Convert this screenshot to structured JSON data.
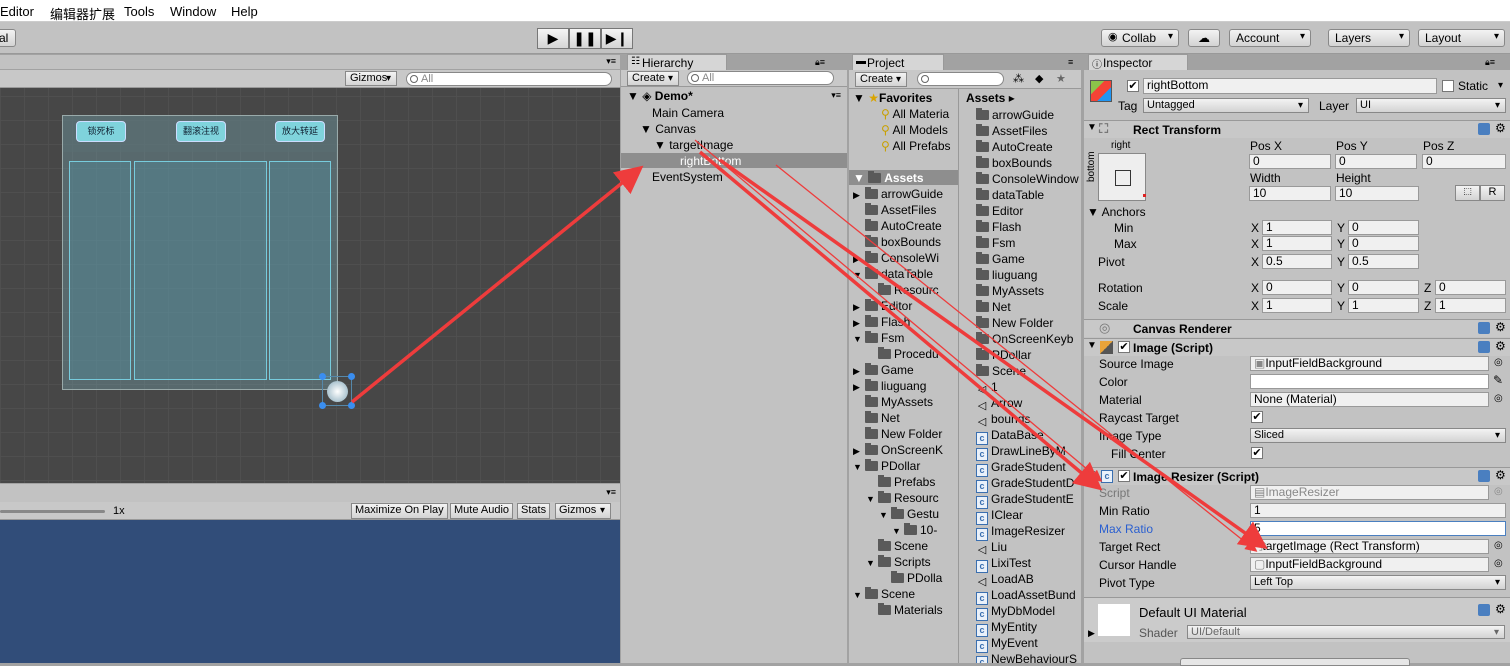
{
  "menu": {
    "items": [
      "Editor",
      "编辑器扩展",
      "Tools",
      "Window",
      "Help"
    ]
  },
  "toolbar": {
    "left_partial": "al",
    "collab": "Collab",
    "account": "Account",
    "layers": "Layers",
    "layout": "Layout"
  },
  "scene": {
    "gizmos": "Gizmos",
    "search_placeholder": "All",
    "ui_buttons": [
      "锁死标",
      "翻滚注视",
      "放大转延"
    ]
  },
  "game": {
    "scale_label": "1x",
    "buttons": [
      "Maximize On Play",
      "Mute Audio",
      "Stats",
      "Gizmos"
    ]
  },
  "hierarchy": {
    "tab": "Hierarchy",
    "create": "Create",
    "search_placeholder": "All",
    "items": [
      "Demo*",
      "Main Camera",
      "Canvas",
      "targetImage",
      "rightBottom",
      "EventSystem"
    ]
  },
  "project": {
    "tab": "Project",
    "create": "Create",
    "favorites": "Favorites",
    "fav_items": [
      "All Materia",
      "All Models",
      "All Prefabs"
    ],
    "assets_root": "Assets",
    "tree": [
      "arrowGuide",
      "AssetFiles",
      "AutoCreate",
      "boxBounds",
      "ConsoleWi",
      "dataTable",
      "Resourc",
      "Editor",
      "Flash",
      "Fsm",
      "Procedu",
      "Game",
      "liuguang",
      "MyAssets",
      "Net",
      "New Folder",
      "OnScreenK",
      "PDollar",
      "Prefabs",
      "Resourc",
      "Gestu",
      "10-",
      "Scene",
      "Scripts",
      "PDolla",
      "Scene",
      "Materials"
    ],
    "assets_header": "Assets",
    "assets": [
      "arrowGuide",
      "AssetFiles",
      "AutoCreate",
      "boxBounds",
      "ConsoleWindow",
      "dataTable",
      "Editor",
      "Flash",
      "Fsm",
      "Game",
      "liuguang",
      "MyAssets",
      "Net",
      "New Folder",
      "OnScreenKeyb",
      "PDollar",
      "Scene",
      "1",
      "Arrow",
      "bounds",
      "DataBase",
      "DrawLineByM",
      "GradeStudent",
      "GradeStudentD",
      "GradeStudentE",
      "IClear",
      "ImageResizer",
      "Liu",
      "LixiTest",
      "LoadAB",
      "LoadAssetBund",
      "MyDbModel",
      "MyEntity",
      "MyEvent",
      "NewBehaviourS"
    ],
    "asset_types": [
      "folder",
      "folder",
      "folder",
      "folder",
      "folder",
      "folder",
      "folder",
      "folder",
      "folder",
      "folder",
      "folder",
      "folder",
      "folder",
      "folder",
      "folder",
      "folder",
      "folder",
      "unity",
      "unity",
      "unity",
      "cs",
      "cs",
      "cs",
      "cs",
      "cs",
      "cs",
      "cs",
      "unity",
      "cs",
      "unity",
      "cs",
      "cs",
      "cs",
      "cs",
      "cs"
    ]
  },
  "inspector": {
    "tab": "Inspector",
    "object_name": "rightBottom",
    "static": "Static",
    "tag_label": "Tag",
    "tag_value": "Untagged",
    "layer_label": "Layer",
    "layer_value": "UI",
    "rect": {
      "title": "Rect Transform",
      "anchor_h": "right",
      "anchor_v": "bottom",
      "posx_label": "Pos X",
      "posy_label": "Pos Y",
      "posz_label": "Pos Z",
      "posx": "0",
      "posy": "0",
      "posz": "0",
      "width_label": "Width",
      "height_label": "Height",
      "width": "10",
      "height": "10",
      "r_button": "R",
      "anchors": "Anchors",
      "min": "Min",
      "max": "Max",
      "min_x": "1",
      "min_y": "0",
      "max_x": "1",
      "max_y": "0",
      "pivot": "Pivot",
      "pivot_x": "0.5",
      "pivot_y": "0.5",
      "rotation": "Rotation",
      "rot_x": "0",
      "rot_y": "0",
      "rot_z": "0",
      "scale": "Scale",
      "scale_x": "1",
      "scale_y": "1",
      "scale_z": "1",
      "x": "X",
      "y": "Y",
      "z": "Z"
    },
    "canvas_renderer": "Canvas Renderer",
    "image": {
      "title": "Image (Script)",
      "source_label": "Source Image",
      "source": "InputFieldBackground",
      "color_label": "Color",
      "material_label": "Material",
      "material": "None (Material)",
      "raycast_label": "Raycast Target",
      "type_label": "Image Type",
      "type": "Sliced",
      "fill_label": "Fill Center"
    },
    "resizer": {
      "title": "Image Resizer (Script)",
      "script_label": "Script",
      "script": "ImageResizer",
      "min_label": "Min Ratio",
      "min": "1",
      "max_label": "Max Ratio",
      "max": "5",
      "target_label": "Target Rect",
      "target": "targetImage (Rect Transform)",
      "cursor_label": "Cursor Handle",
      "cursor": "InputFieldBackground",
      "pivot_label": "Pivot Type",
      "pivot": "Left Top"
    },
    "material": {
      "name": "Default UI Material",
      "shader_label": "Shader",
      "shader": "UI/Default"
    }
  },
  "colors": {
    "accent_arrow": "#ee3c3c",
    "selection": "#8e8e8e",
    "game_bg": "#314d79",
    "scene_bg": "#474747"
  }
}
